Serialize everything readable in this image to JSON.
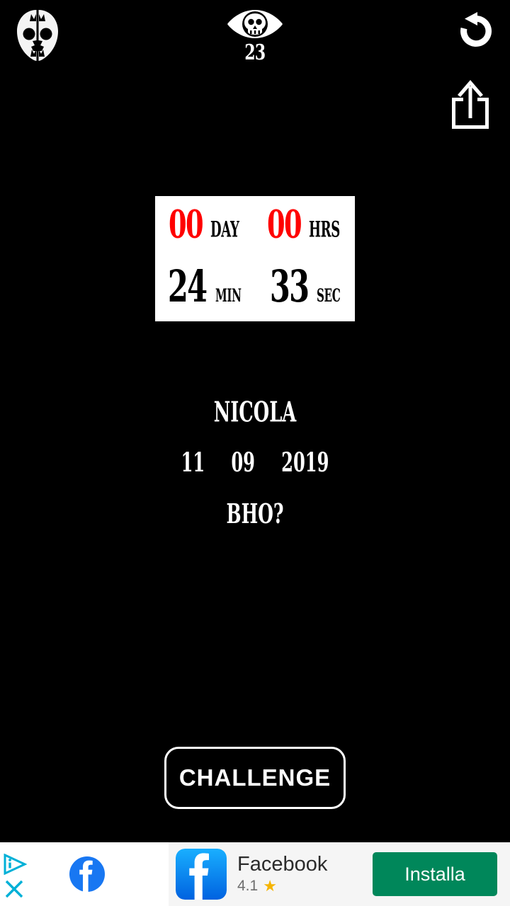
{
  "app": {
    "background_color": "#000000",
    "accent_red": "#FF0000",
    "text_white": "#FFFFFF"
  },
  "top_bar": {
    "skull_icon": "skull-split-icon",
    "eye_icon": "eye-with-skull-icon",
    "eye_count": "23",
    "reset_icon": "reset-arrow-icon",
    "share_icon": "share-upload-icon"
  },
  "countdown": {
    "panel_background": "#FFFFFF",
    "units": [
      {
        "value": "00",
        "label": "DAY",
        "color": "#FF0000"
      },
      {
        "value": "00",
        "label": "HRS",
        "color": "#FF0000"
      },
      {
        "value": "24",
        "label": "MIN",
        "color": "#000000"
      },
      {
        "value": "33",
        "label": "SEC",
        "color": "#000000"
      }
    ]
  },
  "info": {
    "name": "NICOLA",
    "date_day": "11",
    "date_month": "09",
    "date_year": "2019",
    "note": "BHO?"
  },
  "actions": {
    "challenge_label": "CHALLENGE"
  },
  "ad": {
    "adchoices_icon": "adchoices-icon",
    "close_icon": "close-x-icon",
    "brand_logo": "facebook-circle-logo",
    "app_icon": "facebook-app-icon",
    "app_title": "Facebook",
    "rating": "4.1",
    "star_glyph": "★",
    "star_color": "#F5B400",
    "install_label": "Installa",
    "install_color": "#00875A"
  }
}
